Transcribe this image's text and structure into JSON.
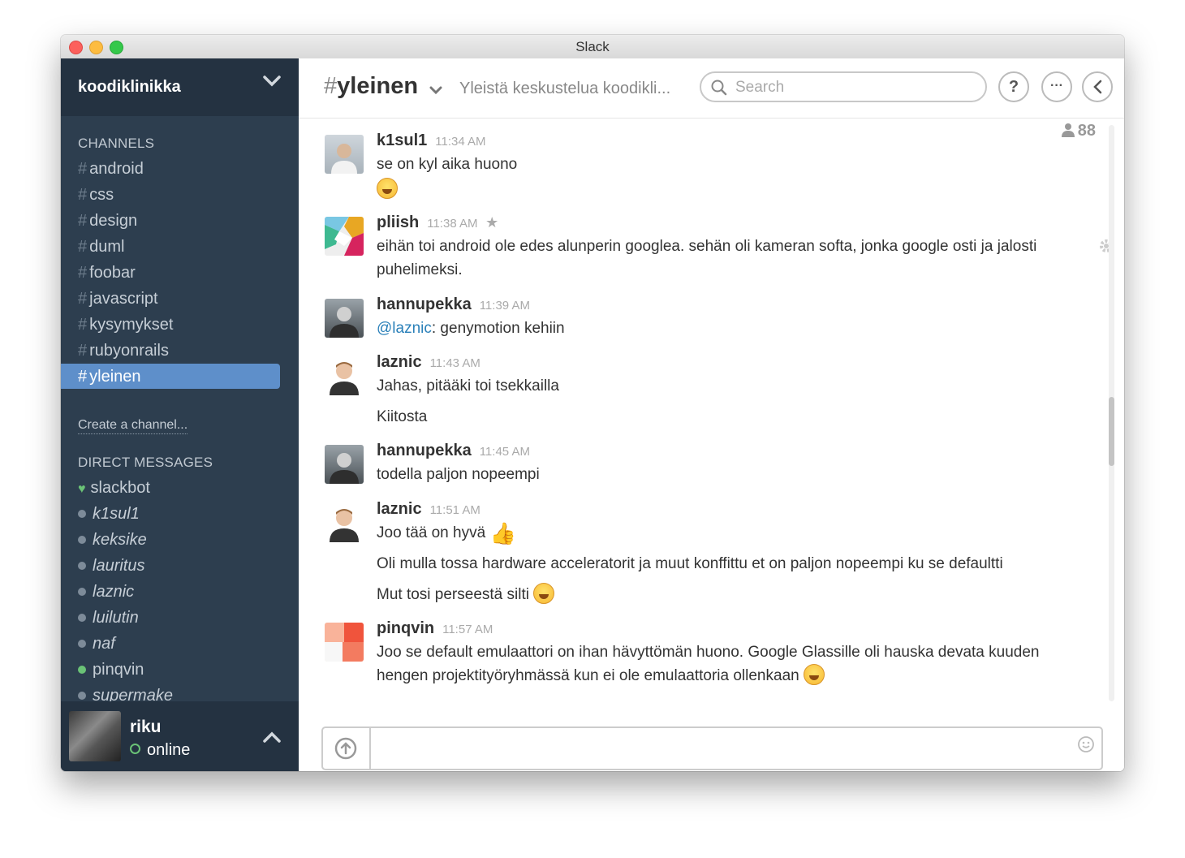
{
  "window": {
    "title": "Slack"
  },
  "sidebar": {
    "team_name": "koodiklinikka",
    "channels_title": "CHANNELS",
    "channels": [
      "android",
      "css",
      "design",
      "duml",
      "foobar",
      "javascript",
      "kysymykset",
      "rubyonrails",
      "yleinen"
    ],
    "active_channel": "yleinen",
    "create_channel": "Create a channel...",
    "dm_title": "DIRECT MESSAGES",
    "dms": [
      {
        "name": "slackbot",
        "status": "bot"
      },
      {
        "name": "k1sul1",
        "status": "away"
      },
      {
        "name": "keksike",
        "status": "away"
      },
      {
        "name": "lauritus",
        "status": "away"
      },
      {
        "name": "laznic",
        "status": "away"
      },
      {
        "name": "luilutin",
        "status": "away"
      },
      {
        "name": "naf",
        "status": "away"
      },
      {
        "name": "pinqvin",
        "status": "online"
      },
      {
        "name": "supermake",
        "status": "away"
      }
    ],
    "user": {
      "name": "riku",
      "status": "online"
    }
  },
  "header": {
    "hash": "#",
    "channel": "yleinen",
    "purpose": "Yleistä keskustelua koodikli...",
    "search_placeholder": "Search",
    "help": "?",
    "more": "···"
  },
  "member_count": "88",
  "messages": [
    {
      "author": "k1sul1",
      "time": "11:34 AM",
      "lines": [
        "se on kyl aika huono"
      ]
    },
    {
      "author": "pliish",
      "time": "11:38 AM",
      "lines": [
        "eihän toi android ole edes alunperin googlea.  sehän oli kameran softa, jonka google osti ja jalosti",
        "puhelimeksi."
      ]
    },
    {
      "author": "hannupekka",
      "time": "11:39 AM",
      "mention": "@laznic",
      "lines": [
        ": genymotion kehiin"
      ]
    },
    {
      "author": "laznic",
      "time": "11:43 AM",
      "lines": [
        "Jahas, pitääki toi tsekkailla",
        "Kiitosta"
      ]
    },
    {
      "author": "hannupekka",
      "time": "11:45 AM",
      "lines": [
        "todella paljon nopeempi"
      ]
    },
    {
      "author": "laznic",
      "time": "11:51 AM",
      "lines": [
        "Joo tää on hyvä",
        "Oli mulla tossa hardware acceleratorit ja muut konffittu et on paljon nopeempi ku se defaultti",
        "Mut tosi perseestä silti"
      ]
    },
    {
      "author": "pinqvin",
      "time": "11:57 AM",
      "lines": [
        "Joo se default emulaattori on ihan hävyttömän huono. Google Glassille oli hauska devata kuuden",
        "hengen projektityöryhmässä kun ei ole emulaattoria ollenkaan"
      ]
    }
  ],
  "colors": {
    "sidebar": "#2d3e4f",
    "active": "#5e8fca",
    "online": "#6ac276"
  }
}
